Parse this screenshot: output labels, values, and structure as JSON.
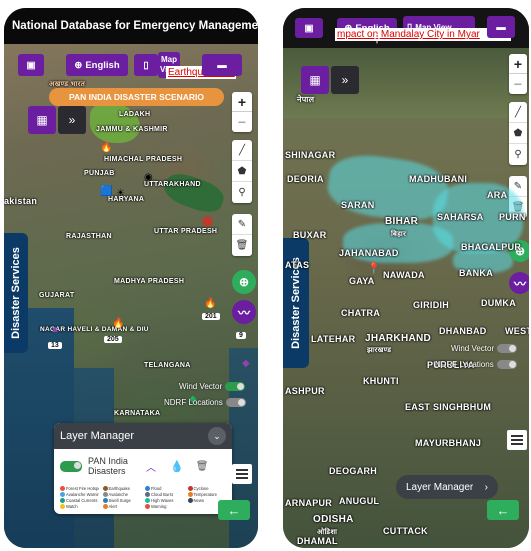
{
  "left": {
    "title": "National Database for Emergency Management",
    "nav": {
      "home_icon": "id-card-icon",
      "language": "English",
      "map_label": "Map View",
      "ticker": "Earthquake Da"
    },
    "scenario_label": "PAN INDIA DISASTER SCENARIO",
    "hindi_label": "अखण्ड भारत",
    "zoom": {
      "in": "+",
      "out": "−"
    },
    "side_tab": "Disaster Services",
    "map_labels": [
      "LADAKH",
      "JAMMU & KASHMIR",
      "HIMACHAL PRADESH",
      "PUNJAB",
      "UTTARAKHAND",
      "HARYANA",
      "UTTAR PRADESH",
      "RAJASTHAN",
      "MADHYA PRADESH",
      "GUJARAT",
      "NAGAR HAVELI & DAMAN & DIU",
      "TELANGANA",
      "KARNATAKA",
      "akistan"
    ],
    "badges": [
      "201",
      "9",
      "13",
      "205"
    ],
    "toggles": [
      {
        "label": "Wind Vector",
        "on": true
      },
      {
        "label": "NDRF Locations",
        "on": false
      }
    ],
    "layer_manager": {
      "title": "Layer Manager",
      "layer_name": "PAN India Disasters",
      "legend": [
        {
          "label": "Forest Fire Hotspot",
          "color": "#e8533d"
        },
        {
          "label": "Earthquake",
          "color": "#8a5a2b"
        },
        {
          "label": "Flood",
          "color": "#2f7fd1"
        },
        {
          "label": "Cyclone",
          "color": "#c0392b"
        },
        {
          "label": "Avalanche Warnings",
          "color": "#4aa3df"
        },
        {
          "label": "Avalanche",
          "color": "#7f8c8d"
        },
        {
          "label": "Cloud Burst",
          "color": "#5d6d7e"
        },
        {
          "label": "Temperature",
          "color": "#e67e22"
        },
        {
          "label": "Coastal Currents",
          "color": "#16a085"
        },
        {
          "label": "Swell Surge",
          "color": "#2980b9"
        },
        {
          "label": "High Waves",
          "color": "#1abc9c"
        },
        {
          "label": "News",
          "color": "#34495e"
        },
        {
          "label": "Watch",
          "color": "#f1c40f"
        },
        {
          "label": "Alert",
          "color": "#e67e22"
        },
        {
          "label": "Warning",
          "color": "#e74c3c"
        }
      ]
    }
  },
  "right": {
    "nav": {
      "language": "English",
      "map_label": "Map View",
      "ticker": "mpact on Mandalay City in Myar"
    },
    "hindi_label": "नेपाल",
    "zoom": {
      "in": "+",
      "out": "−"
    },
    "side_tab": "Disaster Services",
    "map_labels": [
      "SHINAGAR",
      "DEORIA",
      "BUXAR",
      "SARAN",
      "BIHAR",
      "MADHUBANI",
      "SAHARSA",
      "PURN",
      "BHAGALPUR",
      "JAHANABAD",
      "NAWADA",
      "BANKA",
      "GAYA",
      "CHATRA",
      "GIRIDIH",
      "DUMKA",
      "WEST",
      "LATEHAR",
      "JHARKHAND",
      "PURULIYA",
      "KHUNTI",
      "ASHPUR",
      "EAST SINGHBHUM",
      "MAYURBHANJ",
      "DEOGARH",
      "ANUGUL",
      "ARNAPUR",
      "ODISHA",
      "CUTTACK",
      "DHAMAL",
      "ATAS",
      "ARA",
      "BIHAR",
      "बिहार",
      "झारखण्ड",
      "ओडिशा",
      "DHANBAD"
    ],
    "toggles": [
      {
        "label": "Wind Vector",
        "on": false
      },
      {
        "label": "NDRF Locations",
        "on": false
      }
    ],
    "layer_manager_label": "Layer Manager"
  }
}
